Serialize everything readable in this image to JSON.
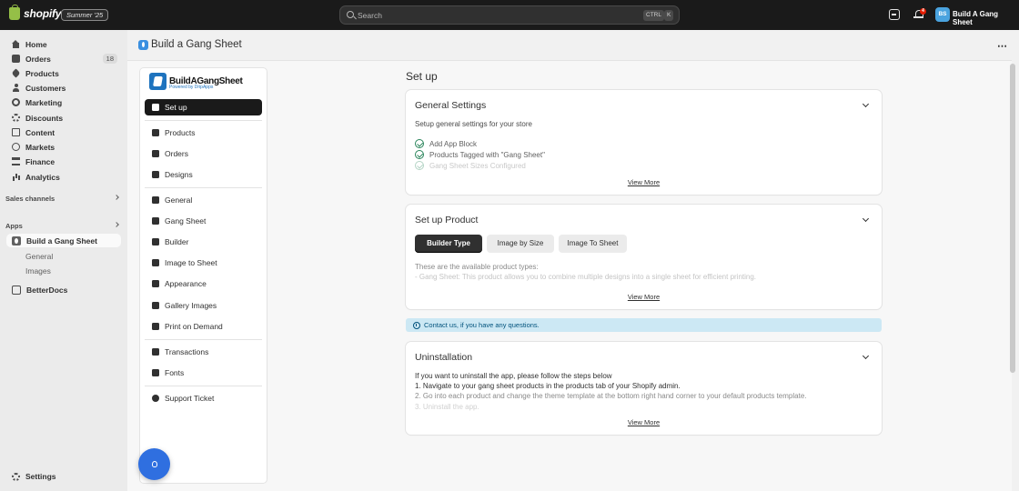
{
  "topbar": {
    "logo_text": "shopify",
    "edition_badge": "Summer '25",
    "search_placeholder": "Search",
    "shortcut_ctrl": "CTRL",
    "shortcut_k": "K",
    "notification_count": "4",
    "avatar_initials": "BS",
    "store_name": "Build A Gang Sheet"
  },
  "sidebar": {
    "items": [
      {
        "label": "Home",
        "icon": "home-icon"
      },
      {
        "label": "Orders",
        "icon": "orders-icon",
        "count": "18"
      },
      {
        "label": "Products",
        "icon": "tag-icon"
      },
      {
        "label": "Customers",
        "icon": "person-icon"
      },
      {
        "label": "Marketing",
        "icon": "target-icon"
      },
      {
        "label": "Discounts",
        "icon": "discount-icon"
      },
      {
        "label": "Content",
        "icon": "content-icon"
      },
      {
        "label": "Markets",
        "icon": "globe-icon"
      },
      {
        "label": "Finance",
        "icon": "bank-icon"
      },
      {
        "label": "Analytics",
        "icon": "chart-icon"
      }
    ],
    "sales_channels": "Sales channels",
    "apps": "Apps",
    "app_active": "Build a Gang Sheet",
    "app_subitems": [
      "General",
      "Images"
    ],
    "other_app": "BetterDocs",
    "settings": "Settings"
  },
  "page": {
    "title": "Build a Gang Sheet",
    "more_actions": "⋯"
  },
  "app_nav": {
    "brand_name": "BuildAGangSheet",
    "brand_sub": "Powered by DripApps",
    "items": [
      "Set up",
      "Products",
      "Orders",
      "Designs",
      "General",
      "Gang Sheet",
      "Builder",
      "Image to Sheet",
      "Appearance",
      "Gallery Images",
      "Print on Demand",
      "Transactions",
      "Fonts",
      "Support Ticket"
    ]
  },
  "main": {
    "title": "Set up",
    "general_settings": {
      "title": "General Settings",
      "desc": "Setup general settings for your store",
      "checks": [
        "Add App Block",
        "Products Tagged with \"Gang Sheet\"",
        "Gang Sheet Sizes Configured"
      ],
      "view_more": "View More"
    },
    "setup_product": {
      "title": "Set up Product",
      "tabs": [
        "Builder Type",
        "Image by Size",
        "Image To Sheet"
      ],
      "line1": "These are the available product types:",
      "line2": "- Gang Sheet: This product allows you to combine multiple designs into a single sheet for efficient printing.",
      "view_more": "View More"
    },
    "contact_banner": "Contact us, if you have any questions.",
    "uninstallation": {
      "title": "Uninstallation",
      "lines": [
        "If you want to uninstall the app, please follow the steps below",
        "1. Navigate to your gang sheet products in the products tab of your Shopify admin.",
        "2. Go into each product and change the theme template at the bottom right hand corner to your default products template.",
        "3. Uninstall the app."
      ],
      "view_more": "View More"
    }
  },
  "colors": {
    "topbar": "#1a1a1a",
    "accent_blue": "#2f6fe0",
    "success_green": "#29845a",
    "info_banner": "#cce8f4"
  }
}
